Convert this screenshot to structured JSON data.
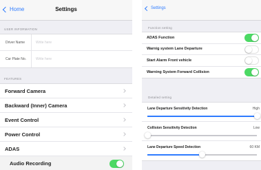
{
  "left": {
    "nav": {
      "back_label": "Home",
      "title": "Settings"
    },
    "user_section": {
      "header": "USER INFORMATION",
      "fields": [
        {
          "label": "Driver Name",
          "placeholder": "Write here",
          "value": ""
        },
        {
          "label": "Car Plate No.",
          "placeholder": "Write here",
          "value": ""
        }
      ]
    },
    "features_section": {
      "header": "FEATURES",
      "items": [
        {
          "label": "Forward Camera"
        },
        {
          "label": "Backward (Inner) Camera"
        },
        {
          "label": "Event Control"
        },
        {
          "label": "Power Control"
        },
        {
          "label": "ADAS"
        }
      ],
      "audio": {
        "label": "Audio Recording",
        "on": true
      }
    }
  },
  "right": {
    "nav": {
      "back_label": "Settings"
    },
    "function_section": {
      "header": "Function setting",
      "items": [
        {
          "label": "ADAS Function",
          "on": true
        },
        {
          "label": "Warnig system Lane Departure",
          "on": false
        },
        {
          "label": "Start Alarm Front vehicle",
          "on": false
        },
        {
          "label": "Warning System Forward Collision",
          "on": true
        }
      ]
    },
    "detail_section": {
      "header": "Detailed setting",
      "sliders": [
        {
          "label": "Lane Departure Sensitivity Detection",
          "value_text": "High",
          "level": 1.0
        },
        {
          "label": "Collision Sensitivity Detection",
          "value_text": "Low",
          "level": 0.0
        },
        {
          "label": "Lane Departure Speed Detection",
          "value_text": "60 KM",
          "level": 0.5
        }
      ]
    }
  },
  "colors": {
    "accent": "#2e7bff",
    "toggle_on": "#4cd964",
    "background": "#efeff4"
  }
}
